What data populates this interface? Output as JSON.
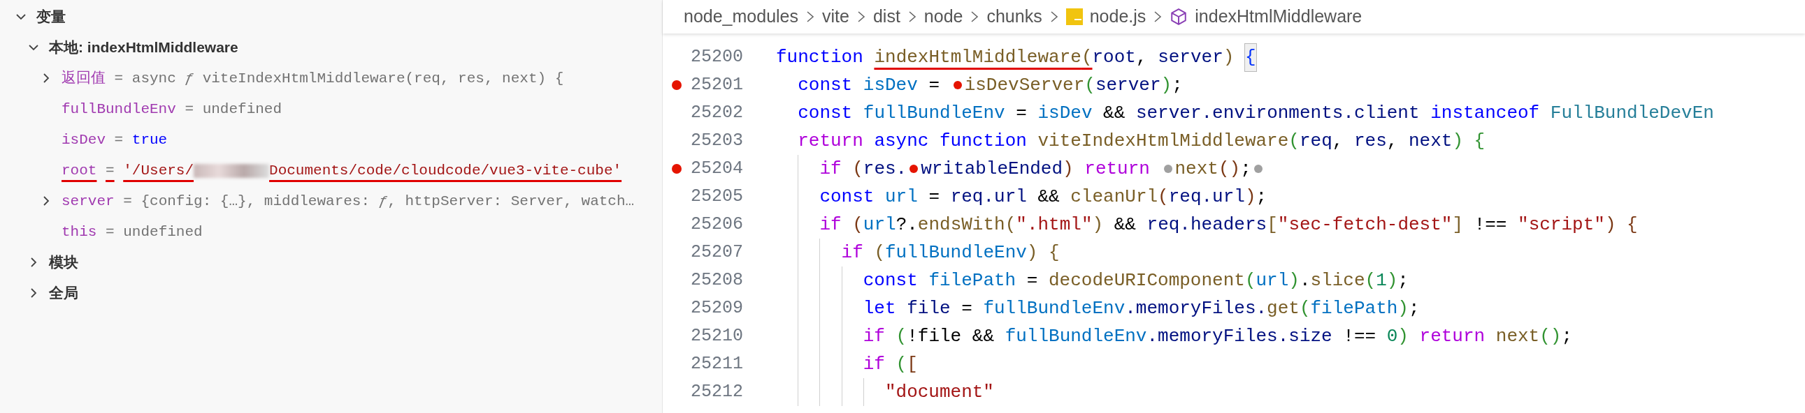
{
  "variables_panel": {
    "tree": [
      {
        "label": "变量",
        "expanded": true,
        "children": [
          {
            "label": "本地: indexHtmlMiddleware",
            "expanded": true,
            "children": [
              {
                "name": "返回值",
                "sep": "=",
                "value": "async *ƒ* viteIndexHtmlMiddleware(req, res, next) {",
                "kind": "object",
                "expanded": false
              },
              {
                "name": "fullBundleEnv",
                "sep": "=",
                "value": "undefined",
                "kind": "undefined"
              },
              {
                "name": "isDev",
                "sep": "=",
                "value": "true",
                "kind": "boolean"
              },
              {
                "name": "root",
                "sep": "=",
                "value": "'/Users/",
                "value_rest": "Documents/code/cloudcode/vue3-vite-cube'",
                "redacted": true,
                "kind": "string",
                "underlined": true
              },
              {
                "name": "server",
                "sep": "=",
                "value": "{config: {…}, middlewares: *ƒ*, httpServer: Server, watch…",
                "kind": "object",
                "expanded": false
              },
              {
                "name": "this",
                "sep": "=",
                "value": "undefined",
                "kind": "undefined"
              }
            ]
          },
          {
            "label": "模块",
            "expanded": false
          },
          {
            "label": "全局",
            "expanded": false
          }
        ]
      }
    ]
  },
  "editor": {
    "breadcrumb": [
      {
        "label": "node_modules"
      },
      {
        "label": "vite"
      },
      {
        "label": "dist"
      },
      {
        "label": "node"
      },
      {
        "label": "chunks"
      },
      {
        "label": "node.js",
        "kind": "file"
      },
      {
        "label": "indexHtmlMiddleware",
        "kind": "symbol"
      }
    ],
    "lines": [
      {
        "number": "25200",
        "breakpoint": false,
        "tokens": [
          {
            "t": "function ",
            "kind": "kw"
          },
          {
            "t": "indexHtmlMiddleware",
            "kind": "fn",
            "underlined": true
          },
          {
            "t": "(",
            "kind": "b1",
            "underlined": true
          },
          {
            "t": "root",
            "kind": "par"
          },
          {
            "t": ", ",
            "kind": "p"
          },
          {
            "t": "server",
            "kind": "par"
          },
          {
            "t": ") ",
            "kind": "b1"
          },
          {
            "t": "{",
            "kind": "match"
          }
        ]
      },
      {
        "number": "25201",
        "breakpoint": true,
        "tokens": [
          {
            "t": "  const ",
            "kind": "kw"
          },
          {
            "t": "isDev",
            "kind": "var"
          },
          {
            "t": " = ",
            "kind": "p"
          },
          {
            "kind": "bp"
          },
          {
            "t": "isDevServer",
            "kind": "fn"
          },
          {
            "t": "(",
            "kind": "b2"
          },
          {
            "t": "server",
            "kind": "par"
          },
          {
            "t": ")",
            "kind": "b2"
          },
          {
            "t": ";",
            "kind": "p"
          }
        ]
      },
      {
        "number": "25202",
        "breakpoint": false,
        "tokens": [
          {
            "t": "  const ",
            "kind": "kw"
          },
          {
            "t": "fullBundleEnv",
            "kind": "var"
          },
          {
            "t": " = ",
            "kind": "p"
          },
          {
            "t": "isDev",
            "kind": "var"
          },
          {
            "t": " && ",
            "kind": "p"
          },
          {
            "t": "server.environments.client ",
            "kind": "par"
          },
          {
            "t": "instanceof ",
            "kind": "kw"
          },
          {
            "t": "FullBundleDevEn",
            "kind": "cls"
          }
        ]
      },
      {
        "number": "25203",
        "breakpoint": false,
        "tokens": [
          {
            "t": "  return ",
            "kind": "ctl"
          },
          {
            "t": "async function ",
            "kind": "kw"
          },
          {
            "t": "viteIndexHtmlMiddleware",
            "kind": "fn"
          },
          {
            "t": "(",
            "kind": "b2"
          },
          {
            "t": "req",
            "kind": "par"
          },
          {
            "t": ", ",
            "kind": "p"
          },
          {
            "t": "res",
            "kind": "par"
          },
          {
            "t": ", ",
            "kind": "p"
          },
          {
            "t": "next",
            "kind": "par"
          },
          {
            "t": ") {",
            "kind": "b2"
          }
        ]
      },
      {
        "number": "25204",
        "breakpoint": true,
        "tokens": [
          {
            "t": "    if",
            "kind": "ctl"
          },
          {
            "t": " (",
            "kind": "b3"
          },
          {
            "t": "res.",
            "kind": "par"
          },
          {
            "kind": "bp"
          },
          {
            "t": "writableEnded",
            "kind": "par"
          },
          {
            "t": ") ",
            "kind": "b3"
          },
          {
            "t": "return ",
            "kind": "ctl"
          },
          {
            "kind": "bpoff"
          },
          {
            "t": "next",
            "kind": "fn"
          },
          {
            "t": "()",
            "kind": "b3"
          },
          {
            "t": ";",
            "kind": "p"
          },
          {
            "kind": "bpoff"
          }
        ]
      },
      {
        "number": "25205",
        "breakpoint": false,
        "tokens": [
          {
            "t": "    const ",
            "kind": "kw"
          },
          {
            "t": "url",
            "kind": "var"
          },
          {
            "t": " = ",
            "kind": "p"
          },
          {
            "t": "req.url",
            "kind": "par"
          },
          {
            "t": " && ",
            "kind": "p"
          },
          {
            "t": "cleanUrl",
            "kind": "fn"
          },
          {
            "t": "(",
            "kind": "b3"
          },
          {
            "t": "req.url",
            "kind": "par"
          },
          {
            "t": ")",
            "kind": "b3"
          },
          {
            "t": ";",
            "kind": "p"
          }
        ]
      },
      {
        "number": "25206",
        "breakpoint": false,
        "tokens": [
          {
            "t": "    if",
            "kind": "ctl"
          },
          {
            "t": " (",
            "kind": "b3"
          },
          {
            "t": "url",
            "kind": "var"
          },
          {
            "t": "?.",
            "kind": "p"
          },
          {
            "t": "endsWith",
            "kind": "fn"
          },
          {
            "t": "(",
            "kind": "b1"
          },
          {
            "t": "\".html\"",
            "kind": "str"
          },
          {
            "t": ")",
            "kind": "b1"
          },
          {
            "t": " && ",
            "kind": "p"
          },
          {
            "t": "req.headers",
            "kind": "par"
          },
          {
            "t": "[",
            "kind": "b1"
          },
          {
            "t": "\"sec-fetch-dest\"",
            "kind": "str"
          },
          {
            "t": "]",
            "kind": "b1"
          },
          {
            "t": " !== ",
            "kind": "p"
          },
          {
            "t": "\"script\"",
            "kind": "str"
          },
          {
            "t": ") {",
            "kind": "b3"
          }
        ]
      },
      {
        "number": "25207",
        "breakpoint": false,
        "tokens": [
          {
            "t": "      if",
            "kind": "ctl"
          },
          {
            "t": " (",
            "kind": "b1"
          },
          {
            "t": "fullBundleEnv",
            "kind": "var"
          },
          {
            "t": ") {",
            "kind": "b1"
          }
        ]
      },
      {
        "number": "25208",
        "breakpoint": false,
        "tokens": [
          {
            "t": "        const ",
            "kind": "kw"
          },
          {
            "t": "filePath",
            "kind": "var"
          },
          {
            "t": " = ",
            "kind": "p"
          },
          {
            "t": "decodeURIComponent",
            "kind": "fn"
          },
          {
            "t": "(",
            "kind": "b2"
          },
          {
            "t": "url",
            "kind": "var"
          },
          {
            "t": ")",
            "kind": "b2"
          },
          {
            "t": ".",
            "kind": "p"
          },
          {
            "t": "slice",
            "kind": "fn"
          },
          {
            "t": "(",
            "kind": "b2"
          },
          {
            "t": "1",
            "kind": "num"
          },
          {
            "t": ")",
            "kind": "b2"
          },
          {
            "t": ";",
            "kind": "p"
          }
        ]
      },
      {
        "number": "25209",
        "breakpoint": false,
        "tokens": [
          {
            "t": "        let ",
            "kind": "kw"
          },
          {
            "t": "file",
            "kind": "par"
          },
          {
            "t": " = ",
            "kind": "p"
          },
          {
            "t": "fullBundleEnv",
            "kind": "var"
          },
          {
            "t": ".memoryFiles.",
            "kind": "par"
          },
          {
            "t": "get",
            "kind": "fn"
          },
          {
            "t": "(",
            "kind": "b2"
          },
          {
            "t": "filePath",
            "kind": "var"
          },
          {
            "t": ")",
            "kind": "b2"
          },
          {
            "t": ";",
            "kind": "p"
          }
        ]
      },
      {
        "number": "25210",
        "breakpoint": false,
        "tokens": [
          {
            "t": "        if",
            "kind": "ctl"
          },
          {
            "t": " (",
            "kind": "b2"
          },
          {
            "t": "!file && ",
            "kind": "p"
          },
          {
            "t": "fullBundleEnv",
            "kind": "var"
          },
          {
            "t": ".memoryFiles.size",
            "kind": "par"
          },
          {
            "t": " !== ",
            "kind": "p"
          },
          {
            "t": "0",
            "kind": "num"
          },
          {
            "t": ") ",
            "kind": "b2"
          },
          {
            "t": "return ",
            "kind": "ctl"
          },
          {
            "t": "next",
            "kind": "fn"
          },
          {
            "t": "()",
            "kind": "b2"
          },
          {
            "t": ";",
            "kind": "p"
          }
        ]
      },
      {
        "number": "25211",
        "breakpoint": false,
        "tokens": [
          {
            "t": "        if",
            "kind": "ctl"
          },
          {
            "t": " (",
            "kind": "b2"
          },
          {
            "t": "[",
            "kind": "b3"
          }
        ]
      },
      {
        "number": "25212",
        "breakpoint": false,
        "tokens": [
          {
            "t": "          \"document\"",
            "kind": "str"
          }
        ]
      }
    ]
  }
}
